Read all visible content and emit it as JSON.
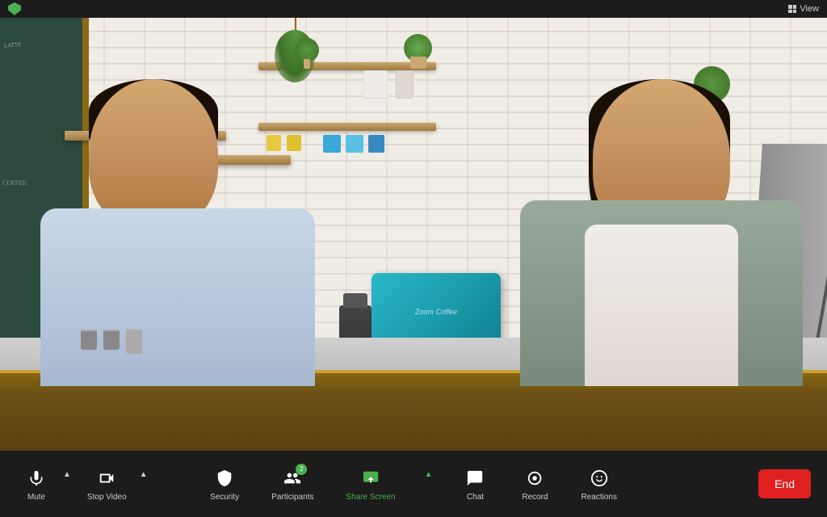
{
  "titlebar": {
    "view_label": "View",
    "shield_color": "#4CAF50"
  },
  "toolbar": {
    "mute_label": "Mute",
    "stop_video_label": "Stop Video",
    "security_label": "Security",
    "participants_label": "Participants",
    "participants_count": "2",
    "share_screen_label": "Share Screen",
    "chat_label": "Chat",
    "record_label": "Record",
    "reactions_label": "Reactions",
    "end_label": "End",
    "accent_green": "#4CAF50",
    "accent_red": "#e02020"
  },
  "video": {
    "alt": "Video call with two participants in a coffee shop setting"
  }
}
